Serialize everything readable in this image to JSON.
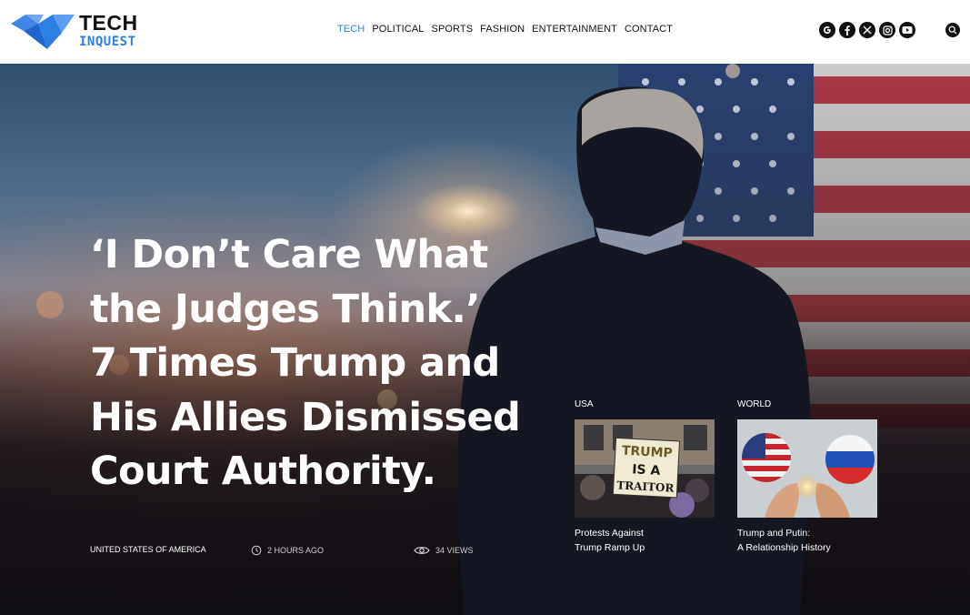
{
  "brand": {
    "title": "TECH",
    "subtitle": "INQUEST"
  },
  "nav": {
    "items": [
      {
        "label": "TECH",
        "active": true
      },
      {
        "label": "POLITICAL",
        "active": false
      },
      {
        "label": "SPORTS",
        "active": false
      },
      {
        "label": "FASHION",
        "active": false
      },
      {
        "label": "ENTERTAINMENT",
        "active": false
      },
      {
        "label": "CONTACT",
        "active": false
      }
    ]
  },
  "social": [
    "google-icon",
    "facebook-icon",
    "x-icon",
    "instagram-icon",
    "youtube-icon"
  ],
  "colors": {
    "accent": "#2d7fe0",
    "text_dark": "#111111",
    "headline": "#ffffff"
  },
  "hero": {
    "headline_lines": [
      "‘I Don’t Care What",
      "the Judges Think.’",
      "7 Times Trump and",
      "His Allies Dismissed",
      "Court Authority."
    ],
    "location": "UNITED STATES OF AMERICA",
    "time": "2 HOURS AGO",
    "views": "34 VIEWS"
  },
  "cards": [
    {
      "category": "USA",
      "title_lines": [
        "Protests Against",
        "Trump Ramp Up"
      ],
      "sign_lines": [
        "TRUMP",
        "IS A",
        "TRAITOR"
      ]
    },
    {
      "category": "WORLD",
      "title_lines": [
        "Trump and Putin:",
        "A Relationship History"
      ]
    }
  ]
}
